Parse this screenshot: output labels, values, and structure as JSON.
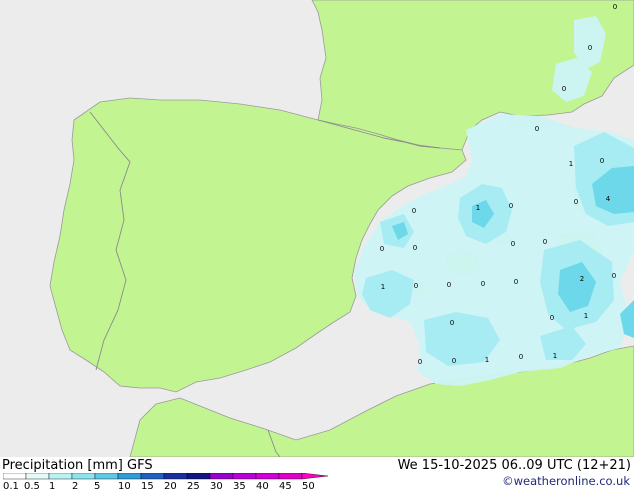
{
  "footer": {
    "title_left": "Precipitation [mm] GFS",
    "title_right": "We 15-10-2025 06..09 UTC (12+21)",
    "credit": "©weatheronline.co.uk"
  },
  "colors": {
    "sea": "#ececec",
    "land": "#c2f592",
    "border": "#8a8a8a",
    "precip_light": "#cdf4f6",
    "precip_mid": "#a6ecf2",
    "precip_heavy": "#6cd8ea"
  },
  "scale": {
    "ticks": [
      "0.1",
      "0.5",
      "1",
      "2",
      "5",
      "10",
      "15",
      "20",
      "25",
      "30",
      "35",
      "40",
      "45",
      "50"
    ],
    "colors": [
      "#ffffff",
      "#e4fbfb",
      "#b8f2f4",
      "#8ce4ee",
      "#5ec9e4",
      "#2f9ed8",
      "#2060c0",
      "#1a30a0",
      "#101880",
      "#9800d0",
      "#b800d8",
      "#d000d8",
      "#e000c8",
      "#ff00c0"
    ]
  },
  "point_values": [
    {
      "value": "0",
      "lon_lat": "NE corner"
    },
    {
      "value": "0",
      "lon_lat": "Alps"
    },
    {
      "value": "0",
      "lon_lat": "Gulf of Lion"
    },
    {
      "value": "0",
      "lon_lat": "Ligurian Sea"
    },
    {
      "value": "1",
      "lon_lat": "Corsica N"
    },
    {
      "value": "0",
      "lon_lat": "Corsica"
    },
    {
      "value": "0",
      "lon_lat": "Corsica E"
    },
    {
      "value": "4",
      "lon_lat": "Tyrrhenian"
    },
    {
      "value": "0",
      "lon_lat": "Catalonia coast"
    },
    {
      "value": "1",
      "lon_lat": "Balearic N"
    },
    {
      "value": "0",
      "lon_lat": "Balearic NE"
    },
    {
      "value": "0",
      "lon_lat": "Valencia"
    },
    {
      "value": "0",
      "lon_lat": "Balearic"
    },
    {
      "value": "0",
      "lon_lat": "Sardinia W"
    },
    {
      "value": "0",
      "lon_lat": "Sardinia"
    },
    {
      "value": "1",
      "lon_lat": "Alicante"
    },
    {
      "value": "0",
      "lon_lat": "Ibiza"
    },
    {
      "value": "0",
      "lon_lat": "Sea 1"
    },
    {
      "value": "0",
      "lon_lat": "Sea 2"
    },
    {
      "value": "0",
      "lon_lat": "Sea 3"
    },
    {
      "value": "2",
      "lon_lat": "Sardinia S"
    },
    {
      "value": "0",
      "lon_lat": "Sardinia SE"
    },
    {
      "value": "0",
      "lon_lat": "Algeria N"
    },
    {
      "value": "0",
      "lon_lat": "Sea 4"
    },
    {
      "value": "1",
      "lon_lat": "Sea 5"
    },
    {
      "value": "0",
      "lon_lat": "Algeria coast 1"
    },
    {
      "value": "0",
      "lon_lat": "Algeria coast 2"
    },
    {
      "value": "1",
      "lon_lat": "Algeria coast 3"
    },
    {
      "value": "0",
      "lon_lat": "Algeria coast 4"
    },
    {
      "value": "1",
      "lon_lat": "Algeria coast 5"
    }
  ]
}
